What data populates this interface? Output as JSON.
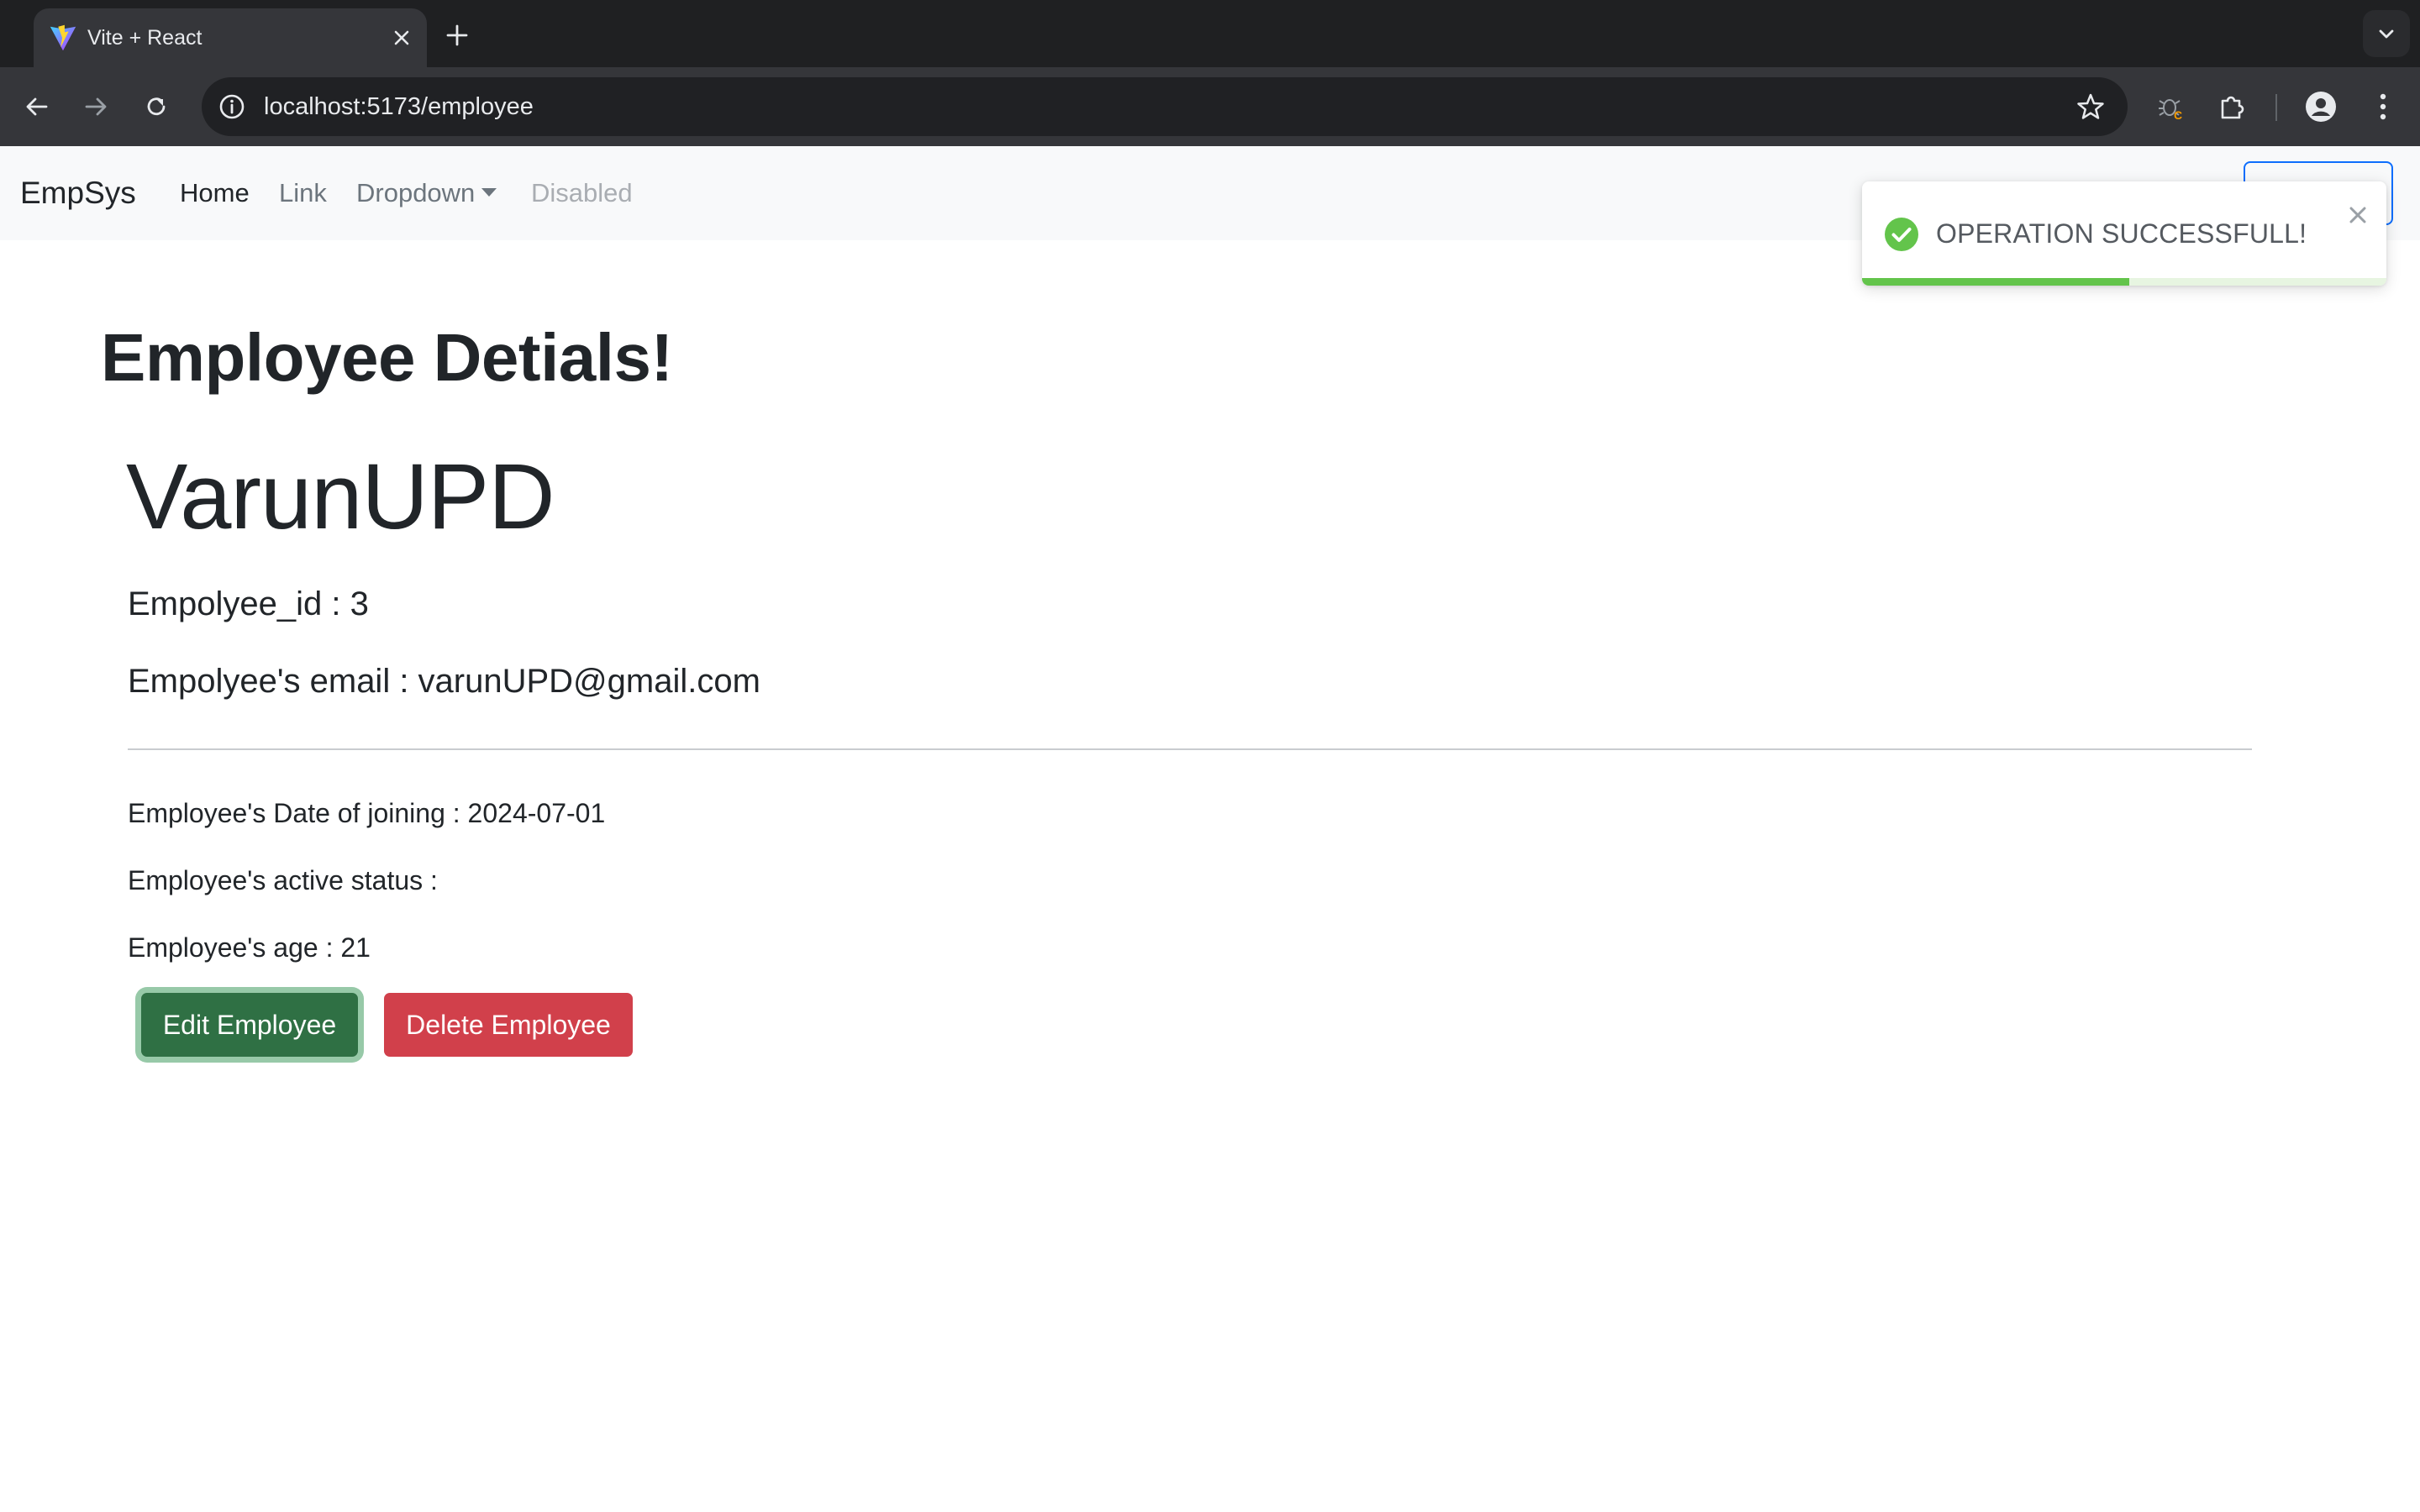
{
  "browser": {
    "tab_title": "Vite + React",
    "url": "localhost:5173/employee",
    "icons": {
      "favicon": "vite-logo-icon",
      "tab_close": "close-icon",
      "new_tab": "plus-icon",
      "tab_search": "chevron-down-icon",
      "back": "arrow-left-icon",
      "forward": "arrow-right-icon",
      "reload": "reload-icon",
      "site_info": "info-icon",
      "bookmark": "star-icon",
      "extension_bug": "bug-extension-icon",
      "extensions": "puzzle-icon",
      "profile": "profile-icon",
      "menu": "kebab-menu-icon"
    }
  },
  "navbar": {
    "brand": "EmpSys",
    "links": {
      "home": "Home",
      "link": "Link",
      "dropdown": "Dropdown",
      "disabled": "Disabled"
    }
  },
  "toast": {
    "message": "OPERATION SUCCESSFULL!",
    "progress_fraction": 0.51,
    "status_color": "#63c44b"
  },
  "page": {
    "title": "Employee Detials!",
    "employee": {
      "name": "VarunUPD",
      "id_line": "Empolyee_id : 3",
      "email_line": "Empolyee's email : varunUPD@gmail.com",
      "doj_line": "Employee's Date of joining : 2024-07-01",
      "status_line": "Employee's active status :",
      "age_line": "Employee's age : 21"
    },
    "actions": {
      "edit": "Edit Employee",
      "delete": "Delete Employee"
    }
  },
  "colors": {
    "success": "#2f7044",
    "danger": "#d1404b",
    "primary": "#0d6efd"
  }
}
